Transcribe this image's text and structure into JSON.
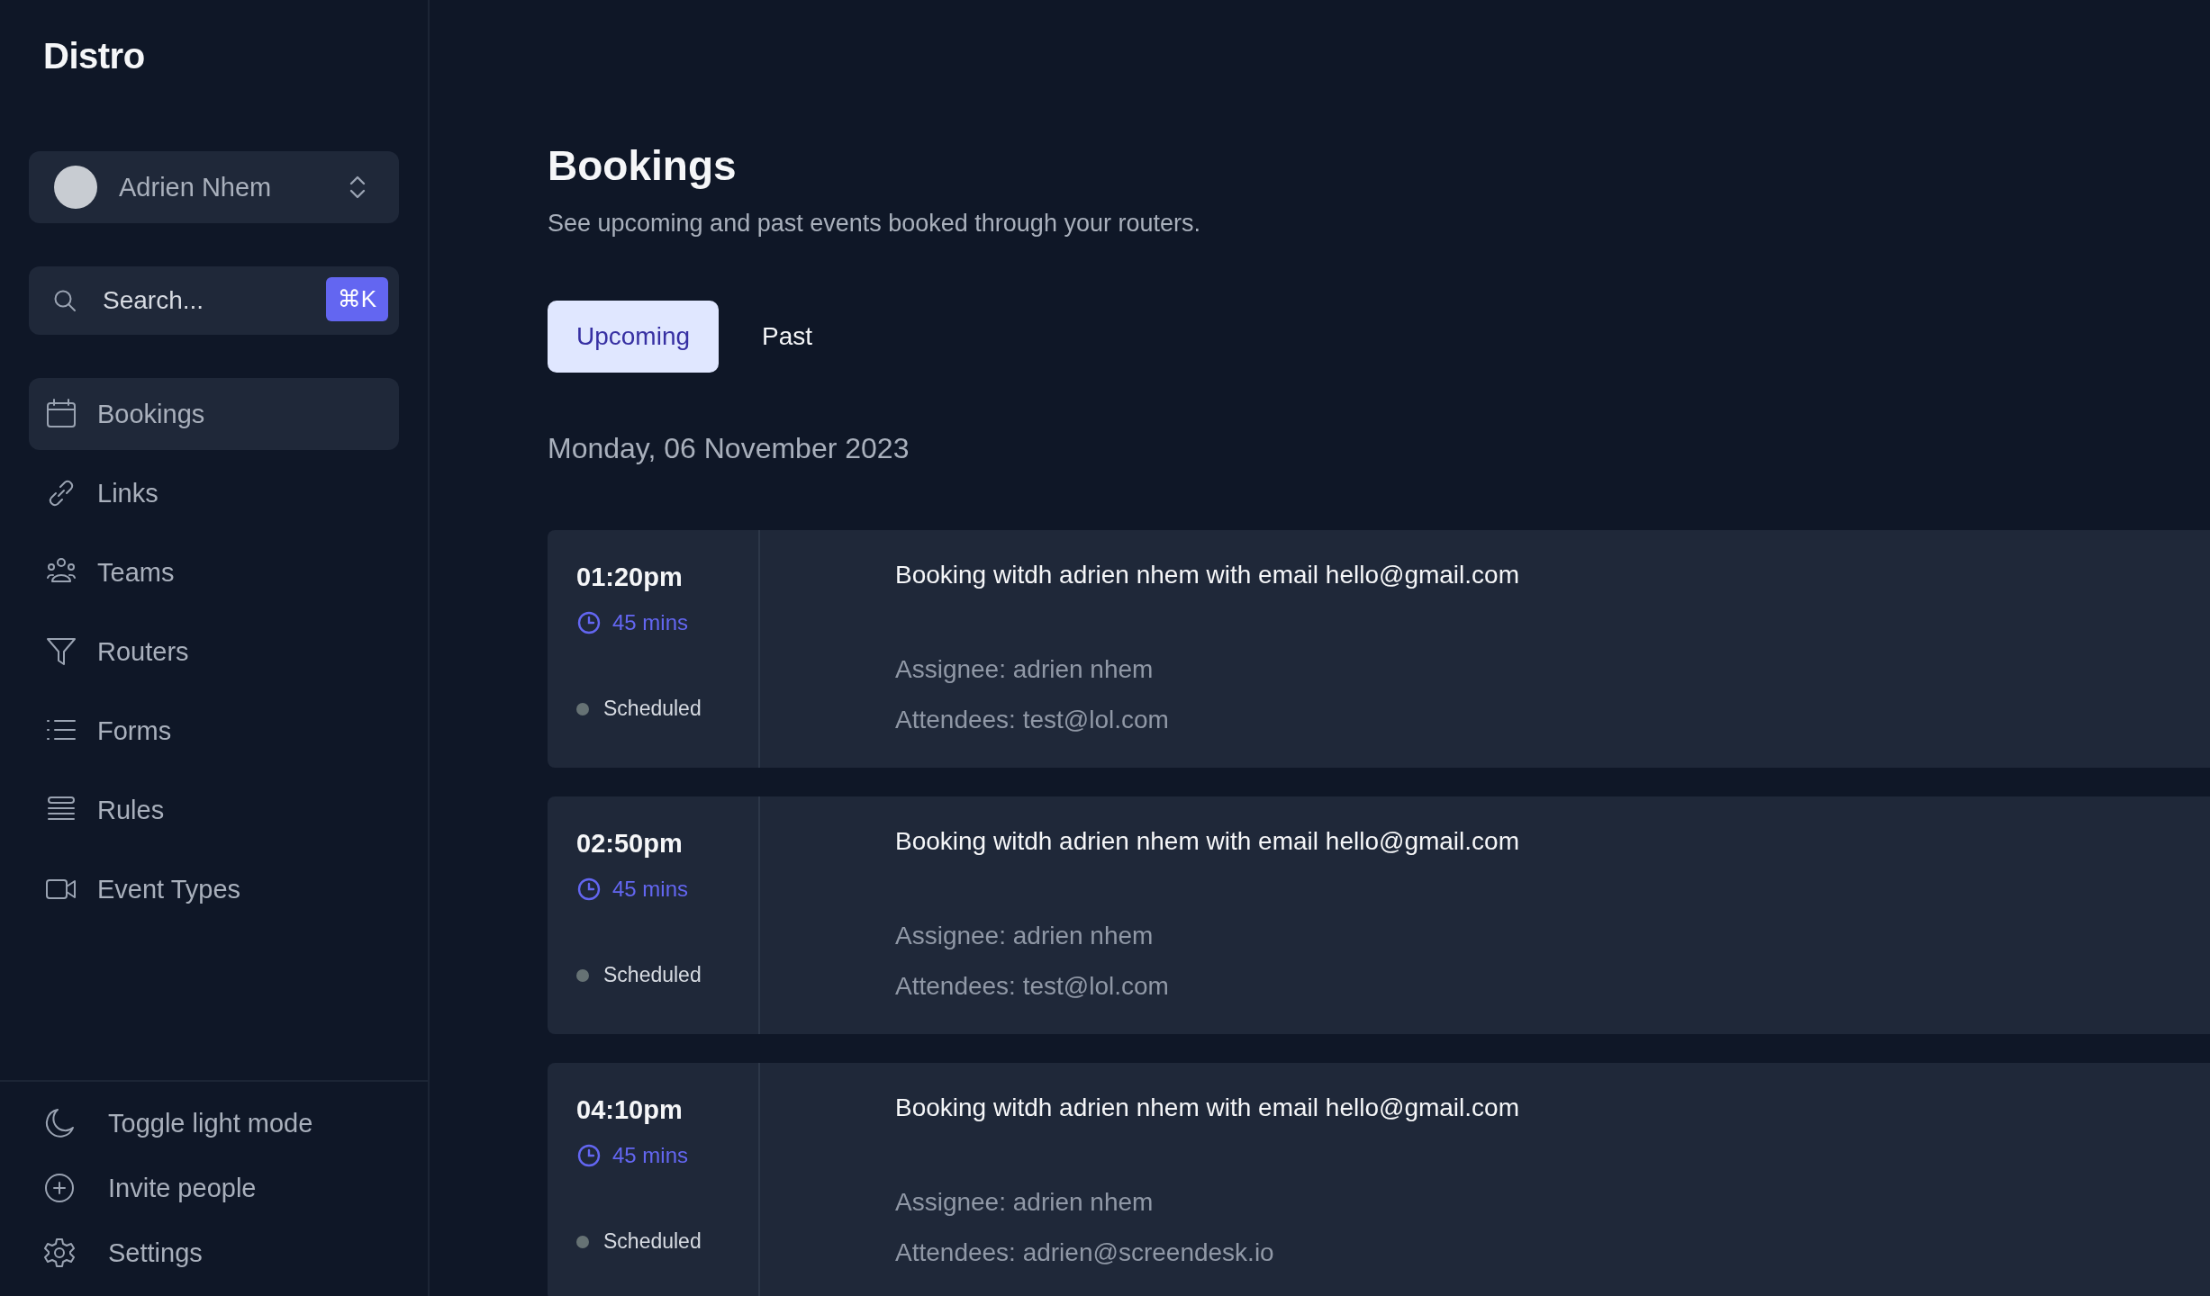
{
  "sidebar": {
    "logo": "Distro",
    "user": {
      "name": "Adrien Nhem"
    },
    "search": {
      "placeholder": "Search...",
      "shortcut": "⌘K"
    },
    "items": [
      {
        "label": "Bookings",
        "selected": true
      },
      {
        "label": "Links",
        "selected": false
      },
      {
        "label": "Teams",
        "selected": false
      },
      {
        "label": "Routers",
        "selected": false
      },
      {
        "label": "Forms",
        "selected": false
      },
      {
        "label": "Rules",
        "selected": false
      },
      {
        "label": "Event Types",
        "selected": false
      }
    ],
    "footer_items": [
      {
        "label": "Toggle light mode"
      },
      {
        "label": "Invite people"
      },
      {
        "label": "Settings"
      }
    ]
  },
  "page": {
    "title": "Bookings",
    "subtitle": "See upcoming and past events booked through your routers.",
    "tabs": [
      {
        "label": "Upcoming",
        "selected": true
      },
      {
        "label": "Past",
        "selected": false
      }
    ],
    "date": "Monday, 06 November 2023",
    "bookings": [
      {
        "time": "01:20pm",
        "duration": "45 mins",
        "status": "Scheduled",
        "title": "Booking witdh adrien nhem with email hello@gmail.com",
        "assignee": "Assignee: adrien nhem",
        "attendees": "Attendees: test@lol.com"
      },
      {
        "time": "02:50pm",
        "duration": "45 mins",
        "status": "Scheduled",
        "title": "Booking witdh adrien nhem with email hello@gmail.com",
        "assignee": "Assignee: adrien nhem",
        "attendees": "Attendees: test@lol.com"
      },
      {
        "time": "04:10pm",
        "duration": "45 mins",
        "status": "Scheduled",
        "title": "Booking witdh adrien nhem with email hello@gmail.com",
        "assignee": "Assignee: adrien nhem",
        "attendees": "Attendees: adrien@screendesk.io"
      }
    ]
  }
}
